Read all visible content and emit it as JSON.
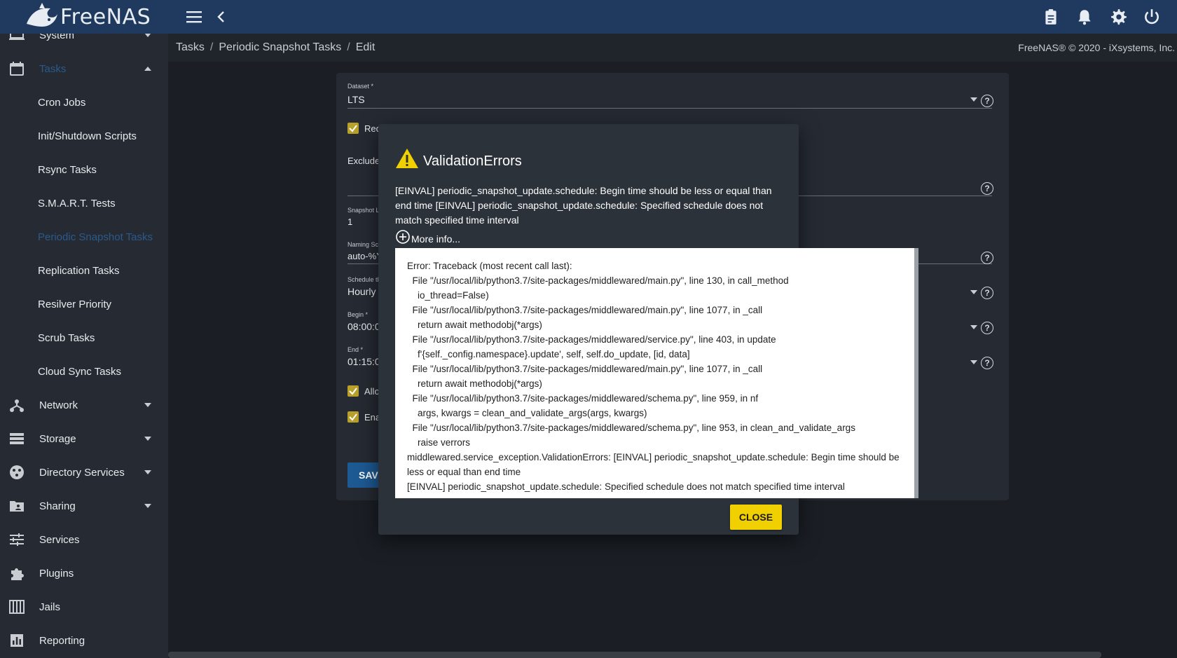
{
  "app": {
    "name": "FreeNAS"
  },
  "topbar": {
    "icons": [
      "menu-icon",
      "back-chevron-icon",
      "clipboard-icon",
      "bell-icon",
      "gear-icon",
      "power-icon"
    ]
  },
  "sidebar": {
    "items": [
      {
        "label": "System",
        "icon": "laptop-icon",
        "caret": "down"
      },
      {
        "label": "Tasks",
        "icon": "calendar-icon",
        "caret": "up",
        "active": true
      },
      {
        "label": "Cron Jobs",
        "sub": true
      },
      {
        "label": "Init/Shutdown Scripts",
        "sub": true
      },
      {
        "label": "Rsync Tasks",
        "sub": true
      },
      {
        "label": "S.M.A.R.T. Tests",
        "sub": true
      },
      {
        "label": "Periodic Snapshot Tasks",
        "sub": true,
        "active": true
      },
      {
        "label": "Replication Tasks",
        "sub": true
      },
      {
        "label": "Resilver Priority",
        "sub": true
      },
      {
        "label": "Scrub Tasks",
        "sub": true
      },
      {
        "label": "Cloud Sync Tasks",
        "sub": true
      },
      {
        "label": "Network",
        "icon": "network-icon",
        "caret": "down"
      },
      {
        "label": "Storage",
        "icon": "storage-icon",
        "caret": "down"
      },
      {
        "label": "Directory Services",
        "icon": "directory-icon",
        "caret": "down"
      },
      {
        "label": "Sharing",
        "icon": "folder-share-icon",
        "caret": "down"
      },
      {
        "label": "Services",
        "icon": "sliders-icon"
      },
      {
        "label": "Plugins",
        "icon": "puzzle-icon"
      },
      {
        "label": "Jails",
        "icon": "jail-icon"
      },
      {
        "label": "Reporting",
        "icon": "chart-icon"
      }
    ]
  },
  "breadcrumb": [
    "Tasks",
    "Periodic Snapshot Tasks",
    "Edit"
  ],
  "copyright": "FreeNAS® © 2020 - iXsystems, Inc.",
  "form": {
    "dataset_label": "Dataset *",
    "dataset_value": "LTS",
    "recursive_label": "Rec",
    "exclude_label": "Exclude",
    "lifetime_label": "Snapshot Li",
    "lifetime_value": "1",
    "naming_label": "Naming Sc",
    "naming_value": "auto-%Y",
    "schedule_label": "Schedule th",
    "schedule_value": "Hourly",
    "begin_label": "Begin *",
    "begin_value": "08:00:0",
    "end_label": "End *",
    "end_value": "01:15:0",
    "allow_label": "Allo",
    "enable_label": "Ena",
    "save_label": "SAVE"
  },
  "dialog": {
    "title": "ValidationErrors",
    "message": "[EINVAL] periodic_snapshot_update.schedule: Begin time should be less or equal than end time [EINVAL] periodic_snapshot_update.schedule: Specified schedule does not match specified time interval",
    "more_info": "More info...",
    "trace": [
      "Error: Traceback (most recent call last):",
      "  File \"/usr/local/lib/python3.7/site-packages/middlewared/main.py\", line 130, in call_method",
      "    io_thread=False)",
      "  File \"/usr/local/lib/python3.7/site-packages/middlewared/main.py\", line 1077, in _call",
      "    return await methodobj(*args)",
      "  File \"/usr/local/lib/python3.7/site-packages/middlewared/service.py\", line 403, in update",
      "    f'{self._config.namespace}.update', self, self.do_update, [id, data]",
      "  File \"/usr/local/lib/python3.7/site-packages/middlewared/main.py\", line 1077, in _call",
      "    return await methodobj(*args)",
      "  File \"/usr/local/lib/python3.7/site-packages/middlewared/schema.py\", line 959, in nf",
      "    args, kwargs = clean_and_validate_args(args, kwargs)",
      "  File \"/usr/local/lib/python3.7/site-packages/middlewared/schema.py\", line 953, in clean_and_validate_args",
      "    raise verrors"
    ],
    "trace_tail": "middlewared.service_exception.ValidationErrors: [EINVAL] periodic_snapshot_update.schedule: Begin time should be less or equal than end time",
    "trace_last": "[EINVAL] periodic_snapshot_update.schedule: Specified schedule does not match specified time interval",
    "close_label": "CLOSE"
  },
  "colors": {
    "topbar": "#1f3a5e",
    "sidebar": "#262b33",
    "accent_yellow": "#f0d000",
    "active_link": "#2a5a8c"
  }
}
